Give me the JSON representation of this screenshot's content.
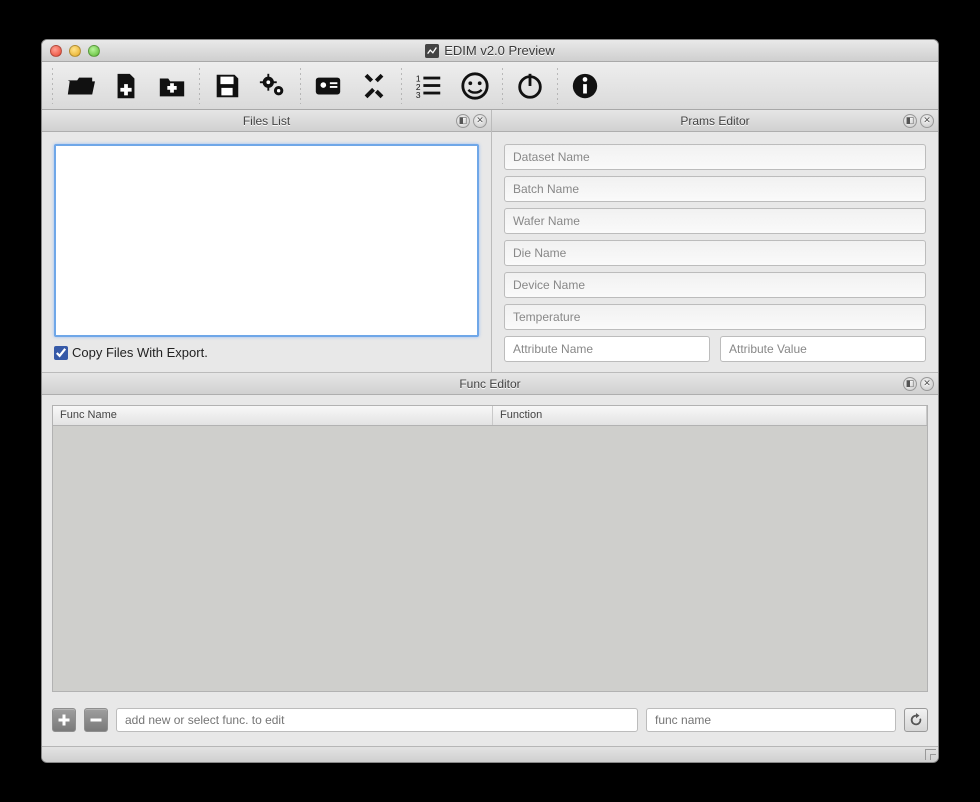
{
  "titlebar": {
    "title": "EDIM v2.0 Preview"
  },
  "panels": {
    "files": {
      "title": "Files List",
      "copy_label": "Copy Files With Export.",
      "copy_checked": true
    },
    "prams": {
      "title": "Prams Editor",
      "fields": {
        "dataset": "Dataset Name",
        "batch": "Batch Name",
        "wafer": "Wafer Name",
        "die": "Die Name",
        "device": "Device Name",
        "temperature": "Temperature",
        "attr_name": "Attribute Name",
        "attr_value": "Attribute Value"
      }
    },
    "func": {
      "title": "Func Editor",
      "columns": {
        "name": "Func Name",
        "function": "Function"
      },
      "add_placeholder": "add new or select func. to edit",
      "name_placeholder": "func name"
    }
  }
}
